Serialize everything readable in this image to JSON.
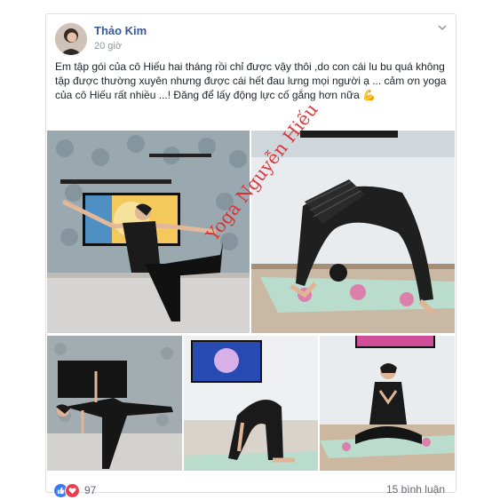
{
  "post": {
    "author": "Thảo Kim",
    "time": "20 giờ",
    "text": "Em tập gói của cô Hiếu hai tháng rồi chỉ được vậy thôi ,do con cái lu bu quá không tập được thường xuyên nhưng được cái hết đau lưng mọi người ạ ... cảm ơn yoga của cô Hiếu rất nhiều ...! Đăng để lấy động lực cố gắng hơn nữa 💪",
    "watermark": "Yoga Nguyễn Hiếu",
    "reaction_count": "97",
    "comments": "15 bình luận"
  },
  "icons": {
    "menu": "chevron-down-icon",
    "like": "like-icon",
    "love": "love-icon"
  },
  "colors": {
    "name": "#385898",
    "like": "#3b7bf6",
    "love": "#ef3b4e",
    "watermark": "#d8282a"
  }
}
